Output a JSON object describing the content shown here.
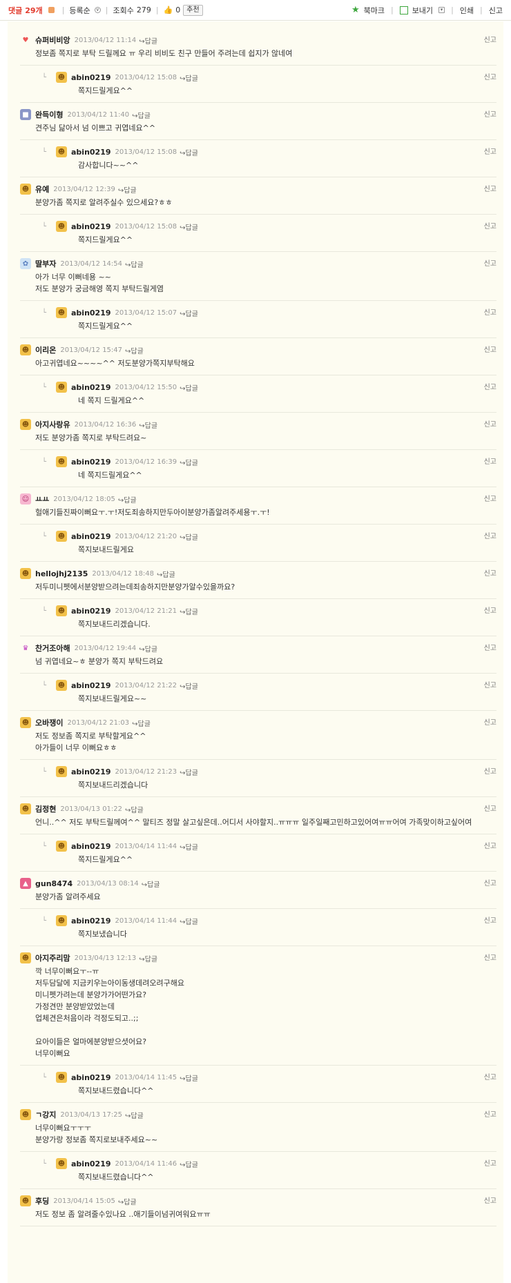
{
  "toolbar": {
    "comments_label": "댓글",
    "comments_count": "29개",
    "sort_label": "등록순",
    "views_label": "조회수",
    "views_count": "279",
    "like_count": "0",
    "recommend_label": "추천",
    "bookmark_label": "북마크",
    "send_label": "보내기",
    "print_label": "인쇄",
    "report_label": "신고"
  },
  "labels": {
    "reply": "답글",
    "report": "신고"
  },
  "comments": [
    {
      "nick": "슈퍼비비앙",
      "date": "2013/04/12 11:14",
      "text": "정보좀 쪽지로 부탁 드릴께요 ㅠ 우리 비비도 친구 만들어 주려는데 쉽지가 않네여",
      "avatar": "heart-icon",
      "reply": {
        "nick": "abin0219",
        "date": "2013/04/12 15:08",
        "text": "쪽지드릴게요^^"
      }
    },
    {
      "nick": "완득이형",
      "date": "2013/04/12 11:40",
      "text": "견주님 닮아서 넘 이쁘고 귀엽네요^^",
      "avatar": "dog-icon",
      "reply": {
        "nick": "abin0219",
        "date": "2013/04/12 15:08",
        "text": "감사합니다~~^^"
      }
    },
    {
      "nick": "유예",
      "date": "2013/04/12 12:39",
      "text": "분양가좀 쪽지로 알려주실수 있으세요?ㅎㅎ",
      "avatar": "face-icon",
      "reply": {
        "nick": "abin0219",
        "date": "2013/04/12 15:08",
        "text": "쪽지드릴게요^^"
      }
    },
    {
      "nick": "딸부자",
      "date": "2013/04/12 14:54",
      "text": "아가 너무 이뻐네용 ~~\n저도 분양가 궁금해영 쪽지 부탁드릴게염",
      "avatar": "kids-icon",
      "reply": {
        "nick": "abin0219",
        "date": "2013/04/12 15:07",
        "text": "쪽지드릴게요^^"
      }
    },
    {
      "nick": "이리온",
      "date": "2013/04/12 15:47",
      "text": "아고귀엽네요~~~~^^ 저도분양가쪽지부탁해요",
      "avatar": "face-icon",
      "reply": {
        "nick": "abin0219",
        "date": "2013/04/12 15:50",
        "text": "네 쪽지 드릴게요^^"
      }
    },
    {
      "nick": "아지사랑유",
      "date": "2013/04/12 16:36",
      "text": "저도 분양가좀 쪽지로 부탁드려요~",
      "avatar": "face-icon",
      "reply": {
        "nick": "abin0219",
        "date": "2013/04/12 16:39",
        "text": "네 쪽지드릴게요^^"
      }
    },
    {
      "nick": "ㅛㅛ",
      "date": "2013/04/12 18:05",
      "text": "헐애기들진짜이뻐요ㅜ.ㅜ!저도죄송하지만두아이분양가좀알려주세용ㅜ.ㅜ!",
      "avatar": "pink-face-icon",
      "reply": {
        "nick": "abin0219",
        "date": "2013/04/12 21:20",
        "text": "쪽지보내드릴게요"
      }
    },
    {
      "nick": "hellojhj2135",
      "date": "2013/04/12 18:48",
      "text": "저두미니펫에서분양받으려는데죄송하지만분양가알수있을까요?",
      "avatar": "face-icon",
      "reply": {
        "nick": "abin0219",
        "date": "2013/04/12 21:21",
        "text": "쪽지보내드리겠습니다."
      }
    },
    {
      "nick": "찬거조아해",
      "date": "2013/04/12 19:44",
      "text": "넘 귀엽네요~ㅎ 분양가 쪽지 부탁드려요",
      "avatar": "crown-icon",
      "reply": {
        "nick": "abin0219",
        "date": "2013/04/12 21:22",
        "text": "쪽지보내드릴게요~~"
      }
    },
    {
      "nick": "오바쟁이",
      "date": "2013/04/12 21:03",
      "text": "저도 정보좀 쪽지로 부탁할게요^^\n아가들이 너무 이뻐요ㅎㅎ",
      "avatar": "face-icon",
      "reply": {
        "nick": "abin0219",
        "date": "2013/04/12 21:23",
        "text": "쪽지보내드리겠습니다"
      }
    },
    {
      "nick": "김정현",
      "date": "2013/04/13 01:22",
      "text": "언니..^^ 저도 부탁드릴께여^^ 말티즈 정말 살고싶은데..어디서 사야할지..ㅠㅠㅠ 일주일째고민하고있어여ㅠㅠ어여 가족맞이하고싶어여",
      "avatar": "face-icon",
      "reply": {
        "nick": "abin0219",
        "date": "2013/04/14 11:44",
        "text": "쪽지드릴게요^^"
      }
    },
    {
      "nick": "gun8474",
      "date": "2013/04/13 08:14",
      "text": "분양가좀 알려주세요",
      "avatar": "pink-icon",
      "reply": {
        "nick": "abin0219",
        "date": "2013/04/14 11:44",
        "text": "쪽지보냈습니다"
      }
    },
    {
      "nick": "아지주리맘",
      "date": "2013/04/13 12:13",
      "text": "깍 너무이뻐요ㅜ--ㅠ\n저두담달에 지금키우는아이동생데려오려구해요\n미니펫가려는데 분양가가어떤가요?\n가정견만 분양받았었는데\n업체견은처음이라 걱정도되고..;;\n\n요아이들은 얼마에분양받으셧어요?\n너무이뻐요",
      "avatar": "face-icon",
      "reply": {
        "nick": "abin0219",
        "date": "2013/04/14 11:45",
        "text": "쪽지보내드렸습니다^^"
      }
    },
    {
      "nick": "ㄱ강지",
      "date": "2013/04/13 17:25",
      "text": "너무이뻐요ㅜㅜㅜ\n분양가랑 정보좀 쪽지로보내주세요~~",
      "avatar": "face-icon",
      "reply": {
        "nick": "abin0219",
        "date": "2013/04/14 11:46",
        "text": "쪽지보내드렸습니다^^"
      }
    },
    {
      "nick": "후딩",
      "date": "2013/04/14 15:05",
      "text": "저도 정보 좀 알려줄수있나요 ..애기들이넘귀여워요ㅠㅠ",
      "avatar": "face-icon",
      "reply": null
    }
  ]
}
